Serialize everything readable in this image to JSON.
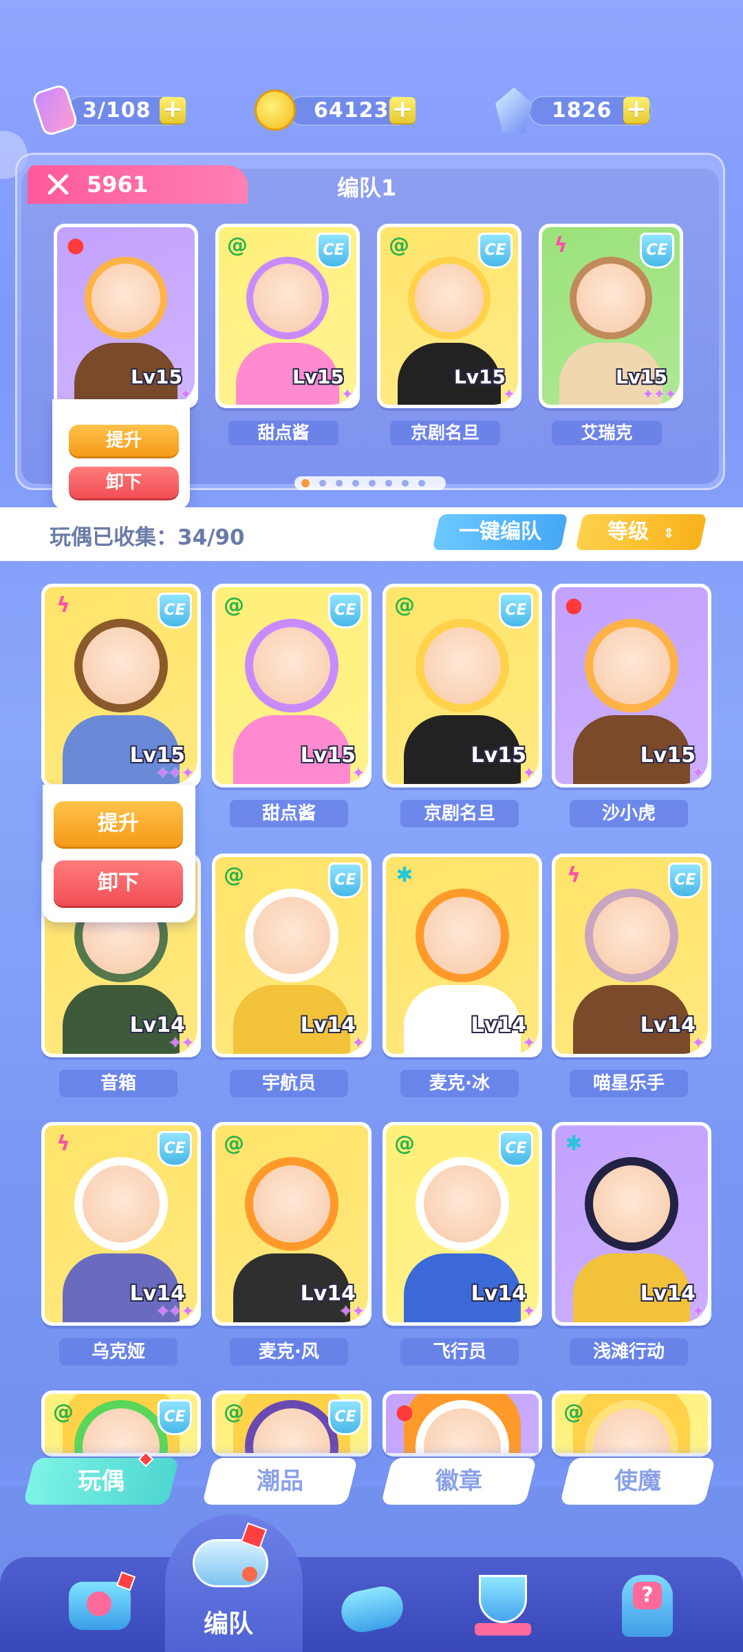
{
  "resources": {
    "stamina": {
      "value": "3/108",
      "icon": "energy-ticket-icon",
      "plus": "+"
    },
    "coins": {
      "value": "64123",
      "icon": "gold-coin-icon",
      "plus": "+"
    },
    "gems": {
      "value": "1826",
      "icon": "crystal-gem-icon",
      "plus": "+"
    }
  },
  "team": {
    "power": "5961",
    "title": "编队1",
    "members": [
      {
        "name": "",
        "level": "Lv15",
        "element": "fire",
        "ce": false,
        "stars": "✦"
      },
      {
        "name": "甜点酱",
        "level": "Lv15",
        "element": "wind",
        "ce": true,
        "stars": "✦"
      },
      {
        "name": "京剧名旦",
        "level": "Lv15",
        "element": "wind",
        "ce": true,
        "stars": "✦"
      },
      {
        "name": "艾瑞克",
        "level": "Lv15",
        "element": "thunder",
        "ce": true,
        "stars": "✦✦✦"
      }
    ],
    "popup": {
      "upgrade": "提升",
      "unequip": "卸下"
    },
    "pages": 8,
    "active_page": 0
  },
  "collection": {
    "label": "玩偶已收集：34/90",
    "one_click": "一键编队",
    "sort": "等级",
    "sort_icon": "sort-arrows-icon"
  },
  "grid_popup": {
    "upgrade": "提升",
    "unequip": "卸下"
  },
  "dolls": [
    {
      "name": "",
      "level": "Lv15",
      "element": "thunder",
      "ce": true,
      "stars": "✦✦✦"
    },
    {
      "name": "甜点酱",
      "level": "Lv15",
      "element": "wind",
      "ce": true,
      "stars": "✦"
    },
    {
      "name": "京剧名旦",
      "level": "Lv15",
      "element": "wind",
      "ce": true,
      "stars": "✦"
    },
    {
      "name": "沙小虎",
      "level": "Lv15",
      "element": "fire",
      "ce": false,
      "stars": "✦"
    },
    {
      "name": "音箱",
      "level": "Lv14",
      "element": "none",
      "ce": false,
      "stars": "✦✦"
    },
    {
      "name": "宇航员",
      "level": "Lv14",
      "element": "wind",
      "ce": true,
      "stars": "✦"
    },
    {
      "name": "麦克·冰",
      "level": "Lv14",
      "element": "ice",
      "ce": false,
      "stars": "✦"
    },
    {
      "name": "喵星乐手",
      "level": "Lv14",
      "element": "thunder",
      "ce": true,
      "stars": "✦"
    },
    {
      "name": "乌克娅",
      "level": "Lv14",
      "element": "thunder",
      "ce": true,
      "stars": "✦✦✦"
    },
    {
      "name": "麦克·风",
      "level": "Lv14",
      "element": "wind",
      "ce": false,
      "stars": "✦✦"
    },
    {
      "name": "飞行员",
      "level": "Lv14",
      "element": "wind",
      "ce": true,
      "stars": "✦"
    },
    {
      "name": "浅滩行动",
      "level": "Lv14",
      "element": "ice",
      "ce": false,
      "stars": "✦"
    },
    {
      "name": "",
      "level": "",
      "element": "wind",
      "ce": true,
      "stars": ""
    },
    {
      "name": "",
      "level": "",
      "element": "wind",
      "ce": true,
      "stars": ""
    },
    {
      "name": "",
      "level": "",
      "element": "fire",
      "ce": false,
      "stars": ""
    },
    {
      "name": "",
      "level": "",
      "element": "wind",
      "ce": false,
      "stars": ""
    }
  ],
  "ce_label": "CE",
  "tabs": [
    {
      "label": "玩偶",
      "active": true
    },
    {
      "label": "潮品",
      "active": false
    },
    {
      "label": "徽章",
      "active": false
    },
    {
      "label": "使魔",
      "active": false
    }
  ],
  "bottom_nav": {
    "items": [
      {
        "icon": "shop-icon",
        "active": false
      },
      {
        "icon": "whistle-team-icon",
        "active": true,
        "label": "编队"
      },
      {
        "icon": "gamepad-icon",
        "active": false
      },
      {
        "icon": "trophy-icon",
        "active": false
      },
      {
        "icon": "gacha-machine-icon",
        "active": false
      }
    ],
    "active_label": "编队"
  },
  "colors": {
    "fire": "#ff3b3b",
    "wind": "#2db34a",
    "thunder": "#ff4fa8",
    "ice": "#24c6d8",
    "accent_orange": "#f59a18",
    "accent_red": "#f14e55"
  }
}
